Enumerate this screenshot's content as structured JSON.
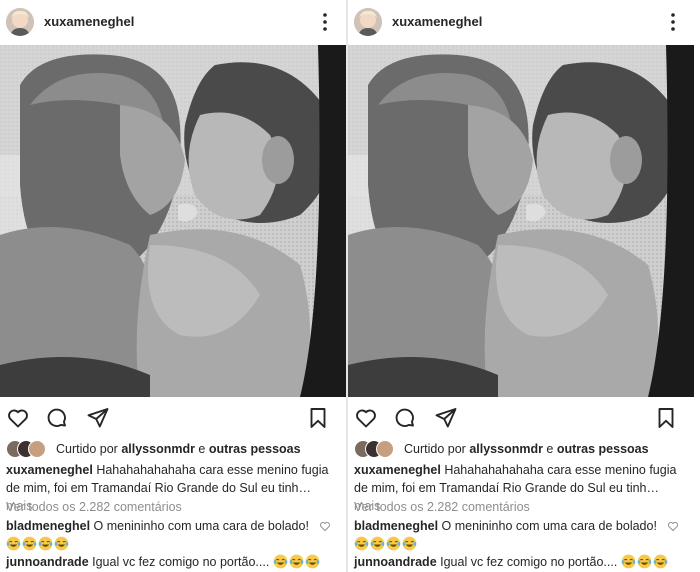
{
  "posts": [
    {
      "username": "xuxameneghel",
      "liked_by_prefix": "Curtido por ",
      "liked_by_user": "allyssonmdr",
      "liked_by_join": " e ",
      "liked_by_others": "outras pessoas",
      "caption_user": "xuxameneghel",
      "caption_line1": " Hahahahahahaha cara esse menino fugia",
      "caption_line2": "de mim, foi em Tramandaí Rio Grande do Sul eu tinh…",
      "caption_more": " mais",
      "view_all_comments": "Ver todos os 2.282 comentários",
      "comments": [
        {
          "user": "bladmeneghel",
          "text": " O menininho com uma cara de bolado!",
          "emoji_count": 4
        },
        {
          "user": "junnoandrade",
          "text": " Igual vc fez comigo no portão.... ",
          "emoji_count": 3
        }
      ]
    },
    {
      "username": "xuxameneghel",
      "liked_by_prefix": "Curtido por ",
      "liked_by_user": "allyssonmdr",
      "liked_by_join": " e ",
      "liked_by_others": "outras pessoas",
      "caption_user": "xuxameneghel",
      "caption_line1": " Hahahahahahaha cara esse menino fugia",
      "caption_line2": "de mim, foi em Tramandaí Rio Grande do Sul eu tinh…",
      "caption_more": " mais",
      "view_all_comments": "Ver todos os 2.282 comentários",
      "comments": [
        {
          "user": "bladmeneghel",
          "text": " O menininho com uma cara de bolado!",
          "emoji_count": 4
        },
        {
          "user": "junnoandrade",
          "text": " Igual vc fez comigo no portão.... ",
          "emoji_count": 3
        }
      ]
    }
  ],
  "icons": {
    "more": "more-options-icon",
    "like": "heart-icon",
    "comment": "comment-icon",
    "share": "share-icon",
    "save": "bookmark-icon",
    "comment_like": "small-heart-icon",
    "emoji": "tears-of-joy-emoji"
  },
  "colors": {
    "text": "#262626",
    "muted": "#8e8e8e",
    "emoji": "#f7c948"
  }
}
